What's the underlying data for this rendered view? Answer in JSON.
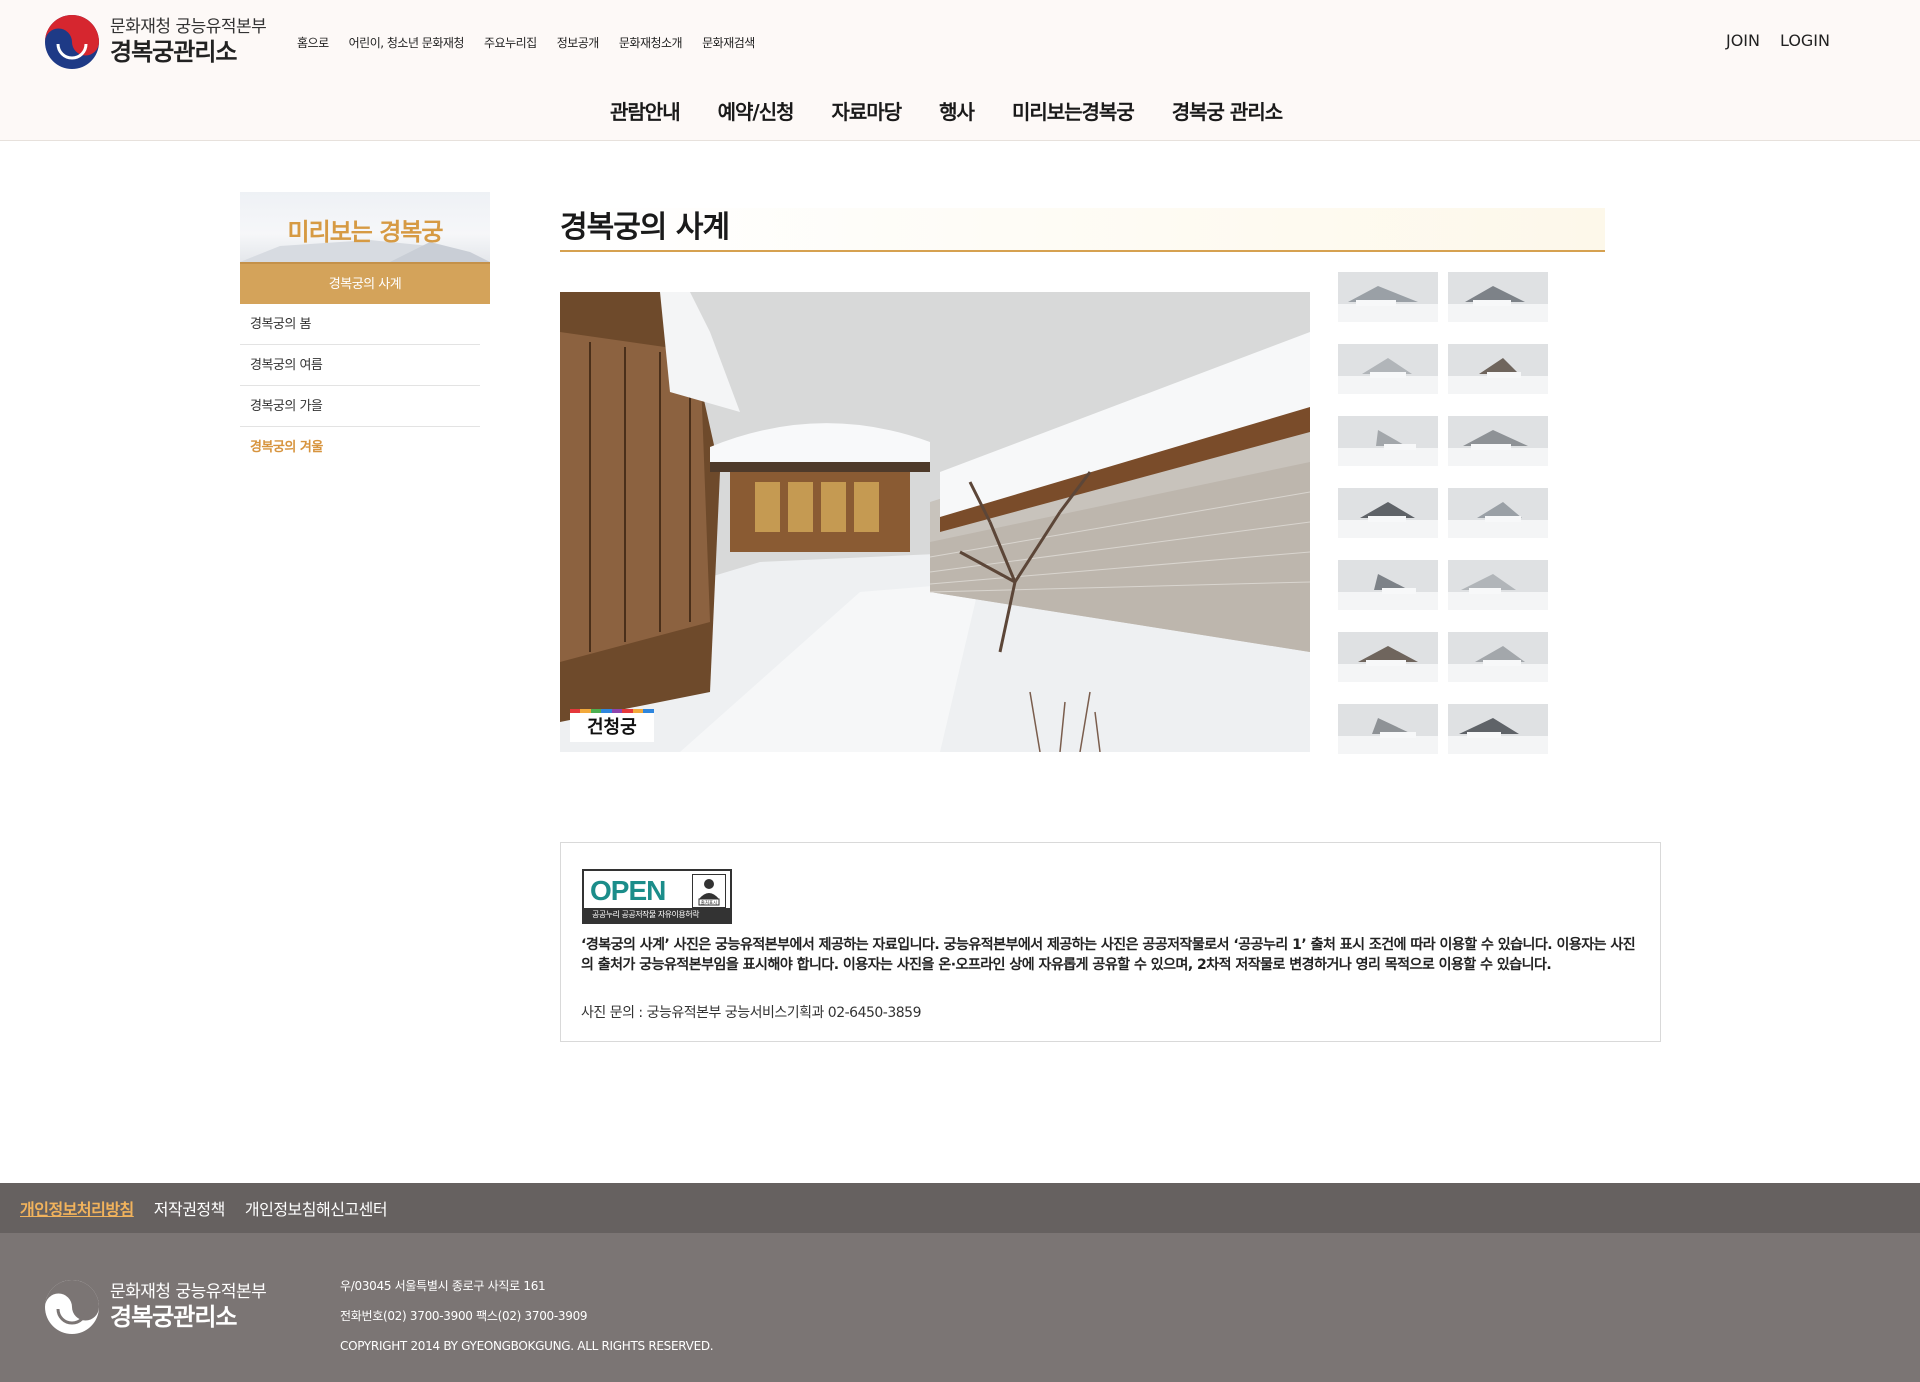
{
  "header": {
    "logo_top": "문화재청 궁능유적본부",
    "logo_bottom": "경복궁관리소",
    "util_nav": [
      "홈으로",
      "어린이, 청소년 문화재청",
      "주요누리집",
      "정보공개",
      "문화재청소개",
      "문화재검색"
    ],
    "join": "JOIN",
    "login": "LOGIN",
    "gnb": [
      "관람안내",
      "예약/신청",
      "자료마당",
      "행사",
      "미리보는경복궁",
      "경복궁 관리소"
    ]
  },
  "lnb": {
    "title": "미리보는 경복궁",
    "active": "경복궁의 사계",
    "items": [
      "경복궁의 봄",
      "경복궁의 여름",
      "경복궁의 가을",
      "경복궁의 겨울"
    ]
  },
  "content": {
    "title": "경복궁의 사계",
    "caption": "건청궁",
    "thumbnail_count": 14
  },
  "notice": {
    "badge_open": "OPEN",
    "badge_sub": "공공누리  공공저작물 자유이용허락",
    "badge_icon": "출처표시",
    "text": "‘경복궁의 사계’ 사진은 궁능유적본부에서 제공하는 자료입니다. 궁능유적본부에서 제공하는 사진은 공공저작물로서 ‘공공누리 1’ 출처 표시 조건에 따라 이용할 수 있습니다. 이용자는 사진의 출처가 궁능유적본부임을 표시해야 합니다. 이용자는 사진을 온·오프라인 상에 자유롭게 공유할 수 있으며, 2차적 저작물로 변경하거나 영리 목적으로 이용할 수 있습니다.",
    "contact": "사진 문의 : 궁능유적본부 궁능서비스기획과 02-6450-3859"
  },
  "footer": {
    "links": [
      "개인정보처리방침",
      "저작권정책",
      "개인정보침해신고센터"
    ],
    "logo_top": "문화재청 궁능유적본부",
    "logo_bottom": "경복궁관리소",
    "address": "우/03045 서울특별시 종로구 사직로 161",
    "phone": "전화번호(02) 3700-3900 팩스(02) 3700-3909",
    "copyright": "COPYRIGHT 2014 BY GYEONGBOKGUNG. ALL RIGHTS RESERVED."
  },
  "colors": {
    "accent": "#d4a35a",
    "accent_text": "#d7943e",
    "footer_bar": "#666160",
    "footer_bg": "#7b7574"
  }
}
